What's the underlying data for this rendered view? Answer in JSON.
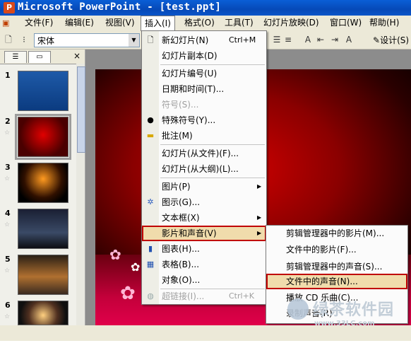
{
  "window": {
    "title": "Microsoft PowerPoint - [test.ppt]",
    "app_icon": "powerpoint-icon"
  },
  "menubar": [
    {
      "label": "文件(F)"
    },
    {
      "label": "编辑(E)"
    },
    {
      "label": "视图(V)"
    },
    {
      "label": "插入(I)"
    },
    {
      "label": "格式(O)"
    },
    {
      "label": "工具(T)"
    },
    {
      "label": "幻灯片放映(D)"
    },
    {
      "label": "窗口(W)"
    },
    {
      "label": "帮助(H)"
    }
  ],
  "toolbar": {
    "font_name": "宋体",
    "design_label": "设计(S)"
  },
  "slides_pane": {
    "close": "×",
    "slides": [
      "1",
      "2",
      "3",
      "4",
      "5",
      "6"
    ],
    "selected": "2"
  },
  "insert_menu": {
    "items": [
      {
        "label": "新幻灯片(N)",
        "shortcut": "Ctrl+M",
        "icon": "new-slide-icon"
      },
      {
        "label": "幻灯片副本(D)"
      },
      {
        "label": "幻灯片编号(U)"
      },
      {
        "label": "日期和时间(T)..."
      },
      {
        "label": "符号(S)...",
        "disabled": true
      },
      {
        "label": "特殊符号(Y)...",
        "icon": "special-symbol-icon"
      },
      {
        "label": "批注(M)",
        "icon": "comment-icon"
      },
      {
        "label": "幻灯片(从文件)(F)..."
      },
      {
        "label": "幻灯片(从大纲)(L)..."
      },
      {
        "label": "图片(P)",
        "submenu": true
      },
      {
        "label": "图示(G)...",
        "icon": "diagram-icon"
      },
      {
        "label": "文本框(X)",
        "submenu": true
      },
      {
        "label": "影片和声音(V)",
        "submenu": true,
        "highlighted": true
      },
      {
        "label": "图表(H)...",
        "icon": "chart-icon"
      },
      {
        "label": "表格(B)...",
        "icon": "table-icon"
      },
      {
        "label": "对象(O)..."
      },
      {
        "label": "超链接(I)...",
        "shortcut": "Ctrl+K",
        "disabled": true,
        "icon": "hyperlink-icon"
      }
    ]
  },
  "media_submenu": {
    "items": [
      {
        "label": "剪辑管理器中的影片(M)..."
      },
      {
        "label": "文件中的影片(F)..."
      },
      {
        "label": "剪辑管理器中的声音(S)..."
      },
      {
        "label": "文件中的声音(N)...",
        "highlighted": true
      },
      {
        "label": "播放 CD 乐曲(C)..."
      },
      {
        "label": "录制声音(R)"
      }
    ]
  },
  "watermark": {
    "text": "绿茶软件园",
    "url": "www.33LC.com"
  }
}
